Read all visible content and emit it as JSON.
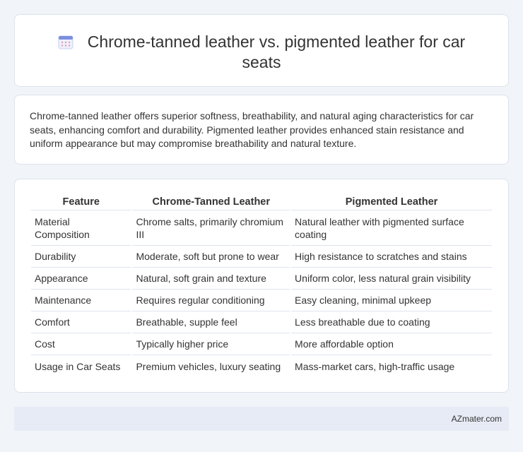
{
  "header": {
    "icon": "calendar-icon",
    "title": "Chrome-tanned leather vs. pigmented leather for car seats"
  },
  "summary": {
    "text": "Chrome-tanned leather offers superior softness, breathability, and natural aging characteristics for car seats, enhancing comfort and durability. Pigmented leather provides enhanced stain resistance and uniform appearance but may compromise breathability and natural texture."
  },
  "table": {
    "headers": [
      "Feature",
      "Chrome-Tanned Leather",
      "Pigmented Leather"
    ],
    "rows": [
      [
        "Material Composition",
        "Chrome salts, primarily chromium III",
        "Natural leather with pigmented surface coating"
      ],
      [
        "Durability",
        "Moderate, soft but prone to wear",
        "High resistance to scratches and stains"
      ],
      [
        "Appearance",
        "Natural, soft grain and texture",
        "Uniform color, less natural grain visibility"
      ],
      [
        "Maintenance",
        "Requires regular conditioning",
        "Easy cleaning, minimal upkeep"
      ],
      [
        "Comfort",
        "Breathable, supple feel",
        "Less breathable due to coating"
      ],
      [
        "Cost",
        "Typically higher price",
        "More affordable option"
      ],
      [
        "Usage in Car Seats",
        "Premium vehicles, luxury seating",
        "Mass-market cars, high-traffic usage"
      ]
    ]
  },
  "footer": {
    "brand": "AZmater.com"
  },
  "colors": {
    "background": "#f1f4f9",
    "card": "#ffffff",
    "border": "#dde3ec",
    "footer": "#e6ebf5",
    "icon_accent": "#7b8fe0"
  }
}
